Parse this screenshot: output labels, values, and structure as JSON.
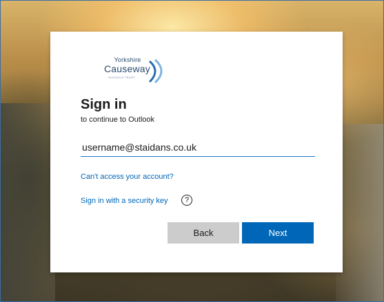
{
  "colors": {
    "accent": "#0067b8",
    "link": "#0067b8",
    "back_button_bg": "#cccccc",
    "card_bg": "#ffffff"
  },
  "logo": {
    "top_text": "Yorkshire",
    "main_text": "Causeway",
    "sub_text": "SCHOOLS TRUST"
  },
  "signin": {
    "title": "Sign in",
    "subtitle": "to continue to Outlook",
    "email_value": "username@staidans.co.uk"
  },
  "links": {
    "cant_access": "Can't access your account?",
    "security_key": "Sign in with a security key",
    "help_icon": "question-circle-icon",
    "help_glyph": "?"
  },
  "buttons": {
    "back": "Back",
    "next": "Next"
  }
}
